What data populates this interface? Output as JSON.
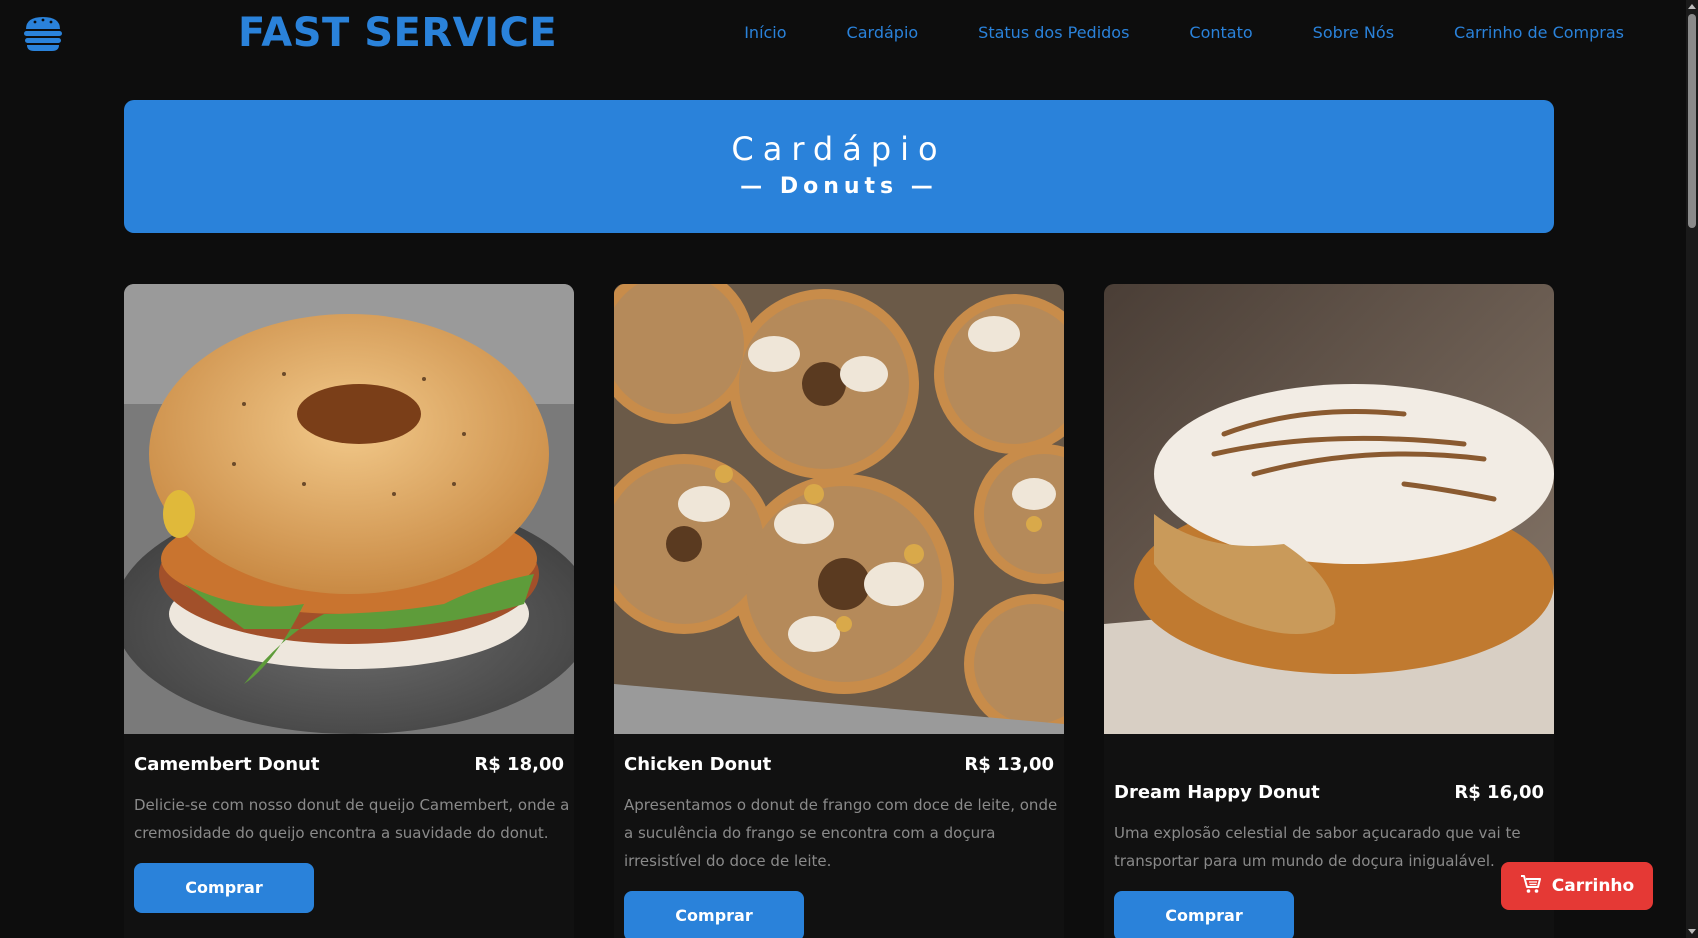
{
  "brand": {
    "name": "FAST SERVICE",
    "logo_icon": "burger-icon"
  },
  "nav": {
    "items": [
      {
        "label": "Início"
      },
      {
        "label": "Cardápio"
      },
      {
        "label": "Status dos Pedidos"
      },
      {
        "label": "Contato"
      },
      {
        "label": "Sobre Nós"
      },
      {
        "label": "Carrinho de Compras"
      }
    ]
  },
  "hero": {
    "title": "Cardápio",
    "subtitle": "— Donuts —"
  },
  "products": [
    {
      "name": "Camembert Donut",
      "price": "R$ 18,00",
      "description": "Delicie-se com nosso donut de queijo Camembert, onde a cremosidade do queijo encontra a suavidade do donut.",
      "button": "Comprar",
      "image": "camembert-donut-photo"
    },
    {
      "name": "Chicken Donut",
      "price": "R$ 13,00",
      "description": "Apresentamos o donut de frango com doce de leite, onde a suculência do frango se encontra com a doçura irresistível do doce de leite.",
      "button": "Comprar",
      "image": "chicken-donut-photo"
    },
    {
      "name": "Dream Happy Donut",
      "price": "R$ 16,00",
      "description": "Uma explosão celestial de sabor açucarado que vai te transportar para um mundo de doçura inigualável.",
      "button": "Comprar",
      "image": "dream-happy-donut-photo"
    }
  ],
  "cart_button": {
    "label": "Carrinho",
    "icon": "shopping-cart-icon"
  },
  "colors": {
    "accent": "#2a82da",
    "background": "#0d0d0d",
    "cart": "#e53935"
  }
}
